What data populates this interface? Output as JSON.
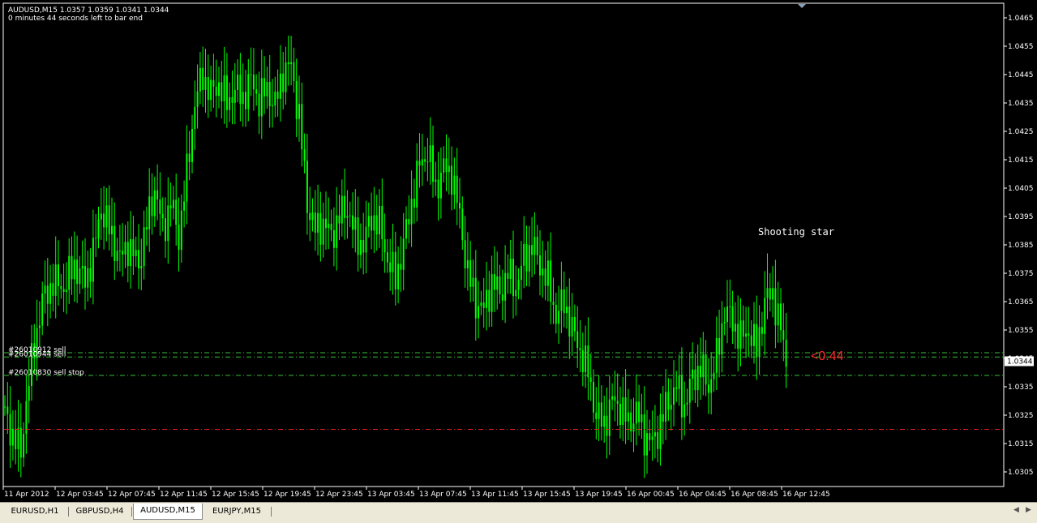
{
  "header": {
    "symbol_line": "AUDUSD,M15  1.0357 1.0359 1.0341 1.0344",
    "timer_line": "0 minutes 44 seconds left to bar end"
  },
  "annotation": {
    "text": "Shooting star"
  },
  "profit_label": {
    "text": "<0.44",
    "color": "#ff2a2a"
  },
  "orders": [
    {
      "label": "#26010912 sell",
      "price": 1.0347,
      "color": "#36c236"
    },
    {
      "label": "#26010944 sell",
      "price": 1.03455,
      "color": "#36c236"
    },
    {
      "label": "#26010830 sell stop",
      "price": 1.0339,
      "color": "#36c236"
    }
  ],
  "stop_line": {
    "price": 1.032,
    "color": "#e02020"
  },
  "tabs": [
    {
      "label": "EURUSD,H1",
      "active": false
    },
    {
      "label": "GBPUSD,H4",
      "active": false
    },
    {
      "label": "AUDUSD,M15",
      "active": true
    },
    {
      "label": "EURJPY,M15",
      "active": false
    }
  ],
  "colors": {
    "candle": "#00ff00",
    "axis": "#ffffff",
    "background": "#000000"
  },
  "chart_data": {
    "type": "candlestick",
    "title": "AUDUSD,M15",
    "ylim": [
      1.03,
      1.0468
    ],
    "y_ticks": [
      "1.0465",
      "1.0455",
      "1.0445",
      "1.0435",
      "1.0425",
      "1.0415",
      "1.0405",
      "1.0395",
      "1.0385",
      "1.0375",
      "1.0365",
      "1.0355",
      "1.0345",
      "1.0335",
      "1.0325",
      "1.0315",
      "1.0305"
    ],
    "current_price": "1.0344",
    "x_tick_labels": [
      "11 Apr 2012",
      "12 Apr 03:45",
      "12 Apr 07:45",
      "12 Apr 11:45",
      "12 Apr 15:45",
      "12 Apr 19:45",
      "12 Apr 23:45",
      "13 Apr 03:45",
      "13 Apr 07:45",
      "13 Apr 11:45",
      "13 Apr 15:45",
      "13 Apr 19:45",
      "16 Apr 00:45",
      "16 Apr 04:45",
      "16 Apr 08:45",
      "16 Apr 12:45"
    ],
    "close_path": [
      [
        0,
        1.0325
      ],
      [
        3,
        1.0318
      ],
      [
        6,
        1.0312
      ],
      [
        8,
        1.033
      ],
      [
        11,
        1.035
      ],
      [
        14,
        1.0365
      ],
      [
        18,
        1.0372
      ],
      [
        22,
        1.037
      ],
      [
        26,
        1.0378
      ],
      [
        30,
        1.0372
      ],
      [
        33,
        1.0382
      ],
      [
        36,
        1.0398
      ],
      [
        40,
        1.0388
      ],
      [
        43,
        1.038
      ],
      [
        46,
        1.0385
      ],
      [
        50,
        1.0378
      ],
      [
        53,
        1.0392
      ],
      [
        56,
        1.0405
      ],
      [
        59,
        1.039
      ],
      [
        62,
        1.04
      ],
      [
        65,
        1.0388
      ],
      [
        68,
        1.041
      ],
      [
        71,
        1.0435
      ],
      [
        74,
        1.0445
      ],
      [
        77,
        1.0438
      ],
      [
        80,
        1.0442
      ],
      [
        83,
        1.0435
      ],
      [
        86,
        1.044
      ],
      [
        89,
        1.0437
      ],
      [
        92,
        1.0443
      ],
      [
        95,
        1.0436
      ],
      [
        98,
        1.044
      ],
      [
        101,
        1.0434
      ],
      [
        104,
        1.0446
      ],
      [
        107,
        1.0448
      ],
      [
        110,
        1.043
      ],
      [
        113,
        1.04
      ],
      [
        116,
        1.039
      ],
      [
        119,
        1.0393
      ],
      [
        122,
        1.0388
      ],
      [
        125,
        1.0395
      ],
      [
        128,
        1.0398
      ],
      [
        131,
        1.0388
      ],
      [
        134,
        1.0385
      ],
      [
        137,
        1.0395
      ],
      [
        140,
        1.0392
      ],
      [
        143,
        1.038
      ],
      [
        146,
        1.0373
      ],
      [
        149,
        1.0385
      ],
      [
        152,
        1.04
      ],
      [
        155,
        1.0413
      ],
      [
        158,
        1.0418
      ],
      [
        161,
        1.0405
      ],
      [
        164,
        1.0412
      ],
      [
        167,
        1.041
      ],
      [
        170,
        1.0395
      ],
      [
        173,
        1.0375
      ],
      [
        176,
        1.0365
      ],
      [
        179,
        1.0362
      ],
      [
        182,
        1.0372
      ],
      [
        185,
        1.0368
      ],
      [
        188,
        1.0375
      ],
      [
        191,
        1.037
      ],
      [
        194,
        1.038
      ],
      [
        197,
        1.0385
      ],
      [
        200,
        1.0378
      ],
      [
        203,
        1.0372
      ],
      [
        206,
        1.036
      ],
      [
        209,
        1.0365
      ],
      [
        212,
        1.0355
      ],
      [
        215,
        1.0348
      ],
      [
        218,
        1.034
      ],
      [
        221,
        1.0325
      ],
      [
        224,
        1.0322
      ],
      [
        227,
        1.033
      ],
      [
        230,
        1.0328
      ],
      [
        233,
        1.0322
      ],
      [
        236,
        1.0326
      ],
      [
        239,
        1.0318
      ],
      [
        242,
        1.0315
      ],
      [
        245,
        1.0322
      ],
      [
        248,
        1.033
      ],
      [
        251,
        1.0335
      ],
      [
        254,
        1.0328
      ],
      [
        257,
        1.0338
      ],
      [
        260,
        1.0342
      ],
      [
        263,
        1.0335
      ],
      [
        266,
        1.0345
      ],
      [
        269,
        1.0362
      ],
      [
        272,
        1.0358
      ],
      [
        275,
        1.0352
      ],
      [
        278,
        1.0355
      ],
      [
        281,
        1.0348
      ],
      [
        284,
        1.0365
      ],
      [
        287,
        1.0368
      ],
      [
        290,
        1.0355
      ],
      [
        292,
        1.0344
      ]
    ]
  }
}
